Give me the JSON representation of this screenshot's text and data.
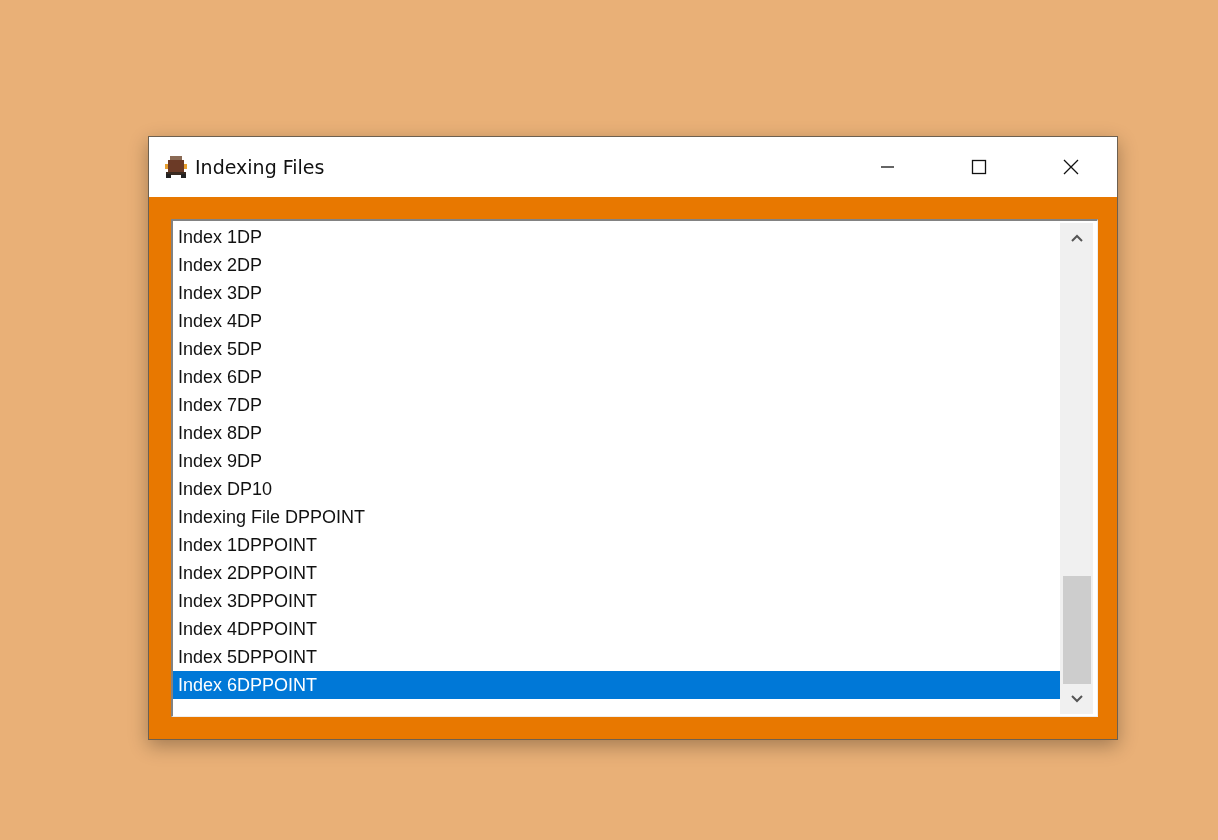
{
  "window": {
    "title": "Indexing Files"
  },
  "list": {
    "items": [
      {
        "label": "Index 1DP",
        "selected": false
      },
      {
        "label": "Index 2DP",
        "selected": false
      },
      {
        "label": "Index 3DP",
        "selected": false
      },
      {
        "label": "Index 4DP",
        "selected": false
      },
      {
        "label": "Index 5DP",
        "selected": false
      },
      {
        "label": "Index 6DP",
        "selected": false
      },
      {
        "label": "Index 7DP",
        "selected": false
      },
      {
        "label": "Index 8DP",
        "selected": false
      },
      {
        "label": "Index 9DP",
        "selected": false
      },
      {
        "label": "Index DP10",
        "selected": false
      },
      {
        "label": "Indexing File DPPOINT",
        "selected": false
      },
      {
        "label": "Index 1DPPOINT",
        "selected": false
      },
      {
        "label": "Index 2DPPOINT",
        "selected": false
      },
      {
        "label": "Index 3DPPOINT",
        "selected": false
      },
      {
        "label": "Index 4DPPOINT",
        "selected": false
      },
      {
        "label": "Index 5DPPOINT",
        "selected": false
      },
      {
        "label": "Index 6DPPOINT",
        "selected": true
      }
    ]
  }
}
